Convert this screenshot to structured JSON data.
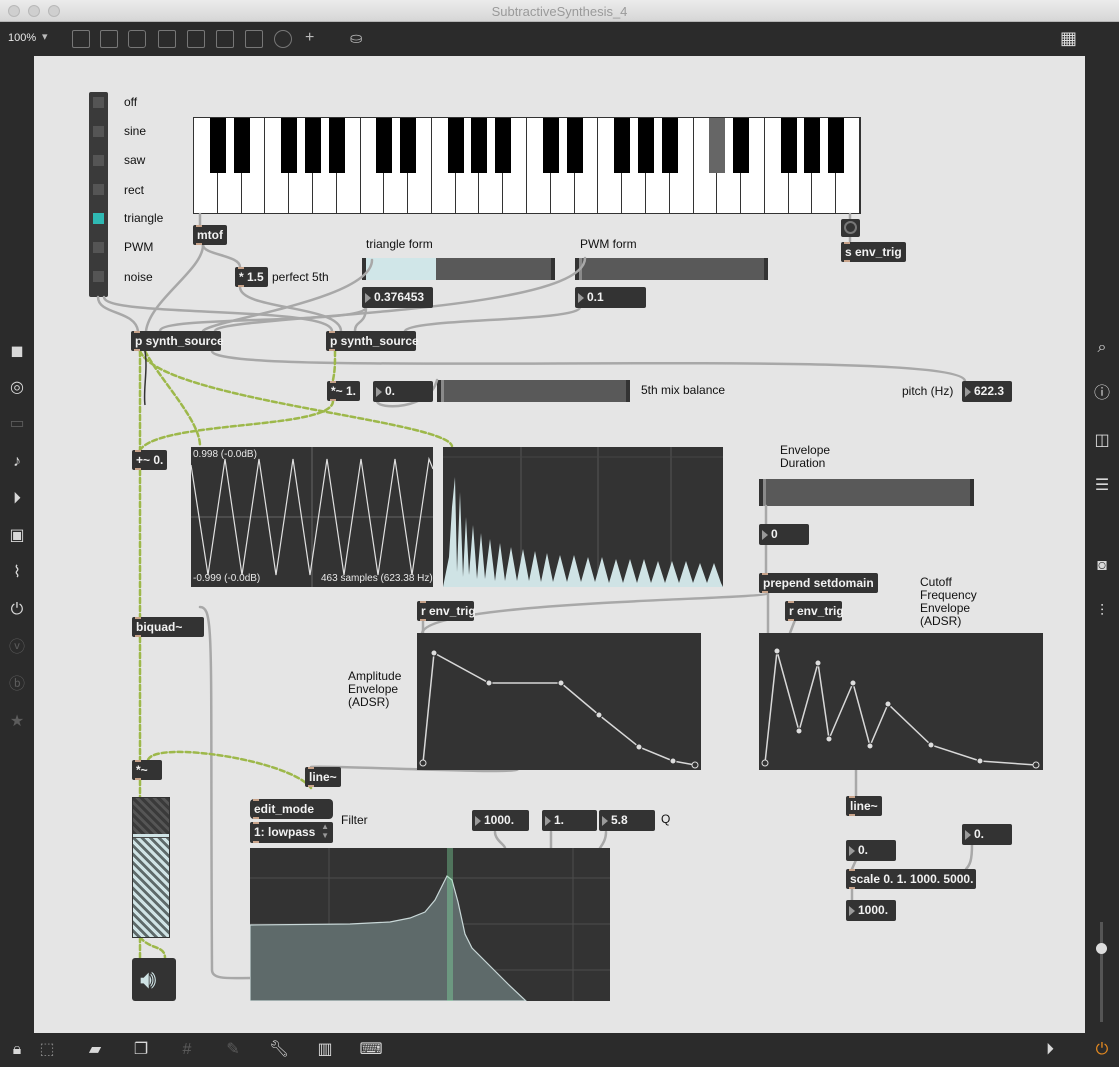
{
  "window": {
    "title": "SubtractiveSynthesis_4",
    "zoom": "100%"
  },
  "radio": {
    "options": [
      "off",
      "sine",
      "saw",
      "rect",
      "triangle",
      "PWM",
      "noise"
    ],
    "selected": "triangle",
    "selected_color": "#2fb9b3"
  },
  "keyboard": {
    "selected_key_color": "#666666"
  },
  "objects": {
    "mtof": "mtof",
    "mul_fifth": "* 1.5",
    "synth1": "p synth_source",
    "synth2": "p synth_source",
    "mix_mul": "*~ 1.",
    "plus": "+~ 0.",
    "biquad": "biquad~",
    "gain_mul": "*~",
    "line_amp": "line~",
    "s_env_trig": "s env_trig",
    "prepend": "prepend setdomain",
    "r_env_trig_amp": "r env_trig",
    "r_env_trig_cut": "r env_trig",
    "line_cut": "line~",
    "scale": "scale 0. 1. 1000. 5000.",
    "edit_mode": "edit_mode",
    "filter_menu": "1: lowpass"
  },
  "numbers": {
    "triangle_form": "0.376453",
    "pwm_form": "0.1",
    "mix": "0.",
    "pitch": "622.3",
    "env_duration": "0",
    "freq": "1000.",
    "gain": "1.",
    "q": "5.8",
    "scale_in": "0.",
    "scale_in2": "0.",
    "scale_out": "1000."
  },
  "labels": {
    "perfect_fifth": "perfect 5th",
    "triangle_form": "triangle form",
    "pwm_form": "PWM form",
    "mix_balance": "5th mix balance",
    "pitch": "pitch (Hz)",
    "env_duration": "Envelope\nDuration",
    "cutoff_env": "Cutoff\nFrequency\nEnvelope\n(ADSR)",
    "amp_env": "Amplitude\nEnvelope\n(ADSR)",
    "filter": "Filter",
    "q": "Q"
  },
  "sliders": {
    "triangle_form_value": 0.376453,
    "pwm_form_value": 0.1,
    "mix_value": 0.0,
    "env_duration_value": 0.0
  },
  "scope": {
    "max_label": "0.998 (-0.0dB)",
    "min_label": "-0.999 (-0.0dB)",
    "samples_label": "463 samples (623.38 Hz)"
  },
  "colors": {
    "object_bg": "#333333",
    "canvas_bg": "#e5e5e5",
    "accent": "#2fb9b3",
    "signal_cable": "#9db84a"
  },
  "icons": {
    "left_sidebar": [
      "cube-icon",
      "circle-icon",
      "tv-icon",
      "music-note-icon",
      "play-step-icon",
      "image-icon",
      "paperclip-icon",
      "plug-icon",
      "v-icon",
      "b-icon",
      "star-icon"
    ],
    "right_sidebar": [
      "search-icon",
      "info-icon",
      "columns-icon",
      "list-icon",
      "camera-icon",
      "sliders-icon"
    ],
    "bottom": [
      "lock-icon",
      "select-icon",
      "presentation-icon",
      "windows-icon",
      "grid-icon",
      "pin-icon",
      "wrench-icon",
      "piano-icon",
      "keyboard-icon",
      "play-circle-icon",
      "power-icon"
    ]
  }
}
